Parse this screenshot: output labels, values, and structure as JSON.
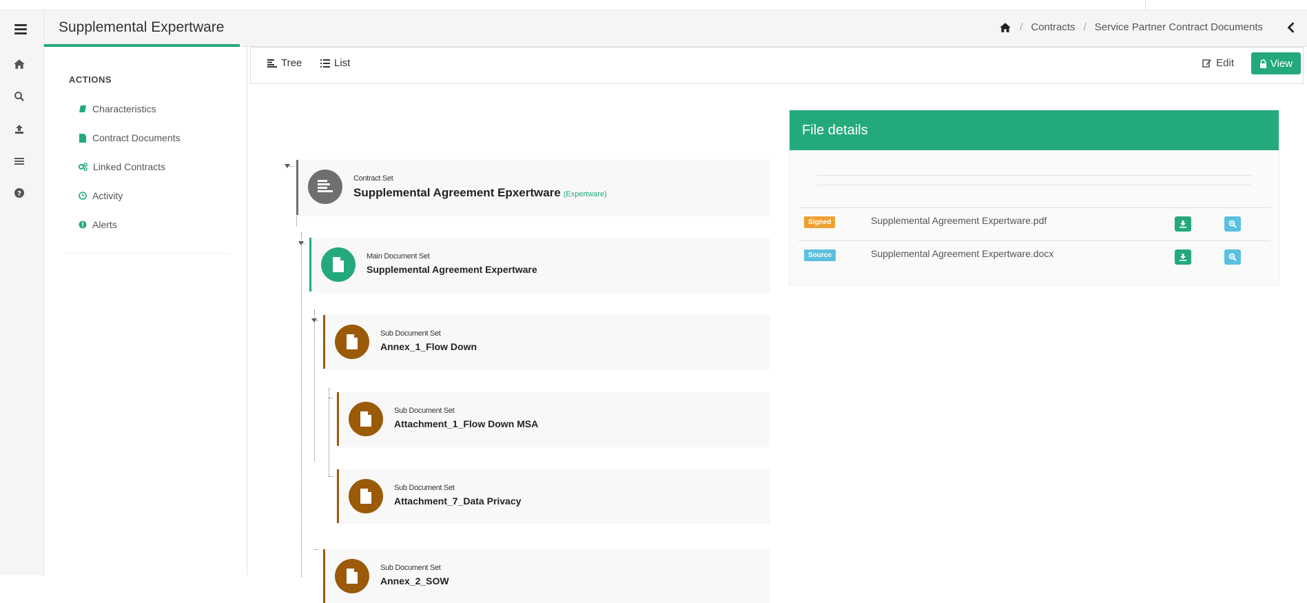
{
  "header": {
    "title": "Supplemental Expertware",
    "breadcrumb": [
      "Contracts",
      "Service Partner Contract Documents"
    ]
  },
  "icon_rail": [
    "menu-icon",
    "home-icon",
    "search-icon",
    "upload-icon",
    "list-icon",
    "help-icon"
  ],
  "sidebar": {
    "actions_title": "ACTIONS",
    "items": [
      {
        "label": "Characteristics",
        "icon": "book-icon"
      },
      {
        "label": "Contract Documents",
        "icon": "file-icon"
      },
      {
        "label": "Linked Contracts",
        "icon": "cogs-icon"
      },
      {
        "label": "Activity",
        "icon": "clock-icon"
      },
      {
        "label": "Alerts",
        "icon": "alert-icon"
      }
    ]
  },
  "toolbar": {
    "tabs": [
      "Tree",
      "List"
    ],
    "edit_label": "Edit",
    "view_label": "View"
  },
  "tree": [
    {
      "kind": "Contract Set",
      "name": "Supplemental Agreement Epxertware",
      "tag": "(Expertware)"
    },
    {
      "kind": "Main Document Set",
      "name": "Supplemental Agreement Expertware"
    },
    {
      "kind": "Sub Document Set",
      "name": "Annex_1_Flow Down"
    },
    {
      "kind": "Sub Document Set",
      "name": "Attachment_1_Flow Down MSA"
    },
    {
      "kind": "Sub Document Set",
      "name": "Attachment_7_Data Privacy"
    },
    {
      "kind": "Sub Document Set",
      "name": "Annex_2_SOW"
    }
  ],
  "file_details": {
    "title": "File details",
    "files": [
      {
        "badge": "Signed",
        "badge_color": "#f0a030",
        "name": "Supplemental Agreement Expertware.pdf"
      },
      {
        "badge": "Source",
        "badge_color": "#5bc0de",
        "name": "Supplemental Agreement Expertware.docx"
      }
    ]
  },
  "colors": {
    "accent": "#24aa7a",
    "contract_set": "#6f6f6f",
    "sub_set": "#9a5a08",
    "info": "#5bc0de"
  }
}
